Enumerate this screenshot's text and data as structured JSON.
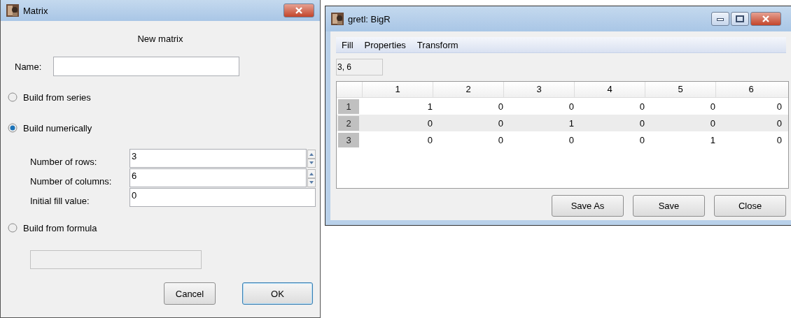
{
  "matrix_dialog": {
    "title": "Matrix",
    "heading": "New matrix",
    "name_label": "Name:",
    "options": [
      {
        "label": "Build from series",
        "selected": false
      },
      {
        "label": "Build numerically",
        "selected": true,
        "fields": [
          {
            "label": "Number of rows:",
            "value": "3",
            "kind": "spin"
          },
          {
            "label": "Number of columns:",
            "value": "6",
            "kind": "spin"
          },
          {
            "label": "Initial fill value:",
            "value": "0",
            "kind": "entry"
          }
        ]
      },
      {
        "label": "Build from formula",
        "selected": false
      }
    ],
    "buttons": [
      {
        "label": "Cancel",
        "selected": false
      },
      {
        "label": "OK",
        "selected": true
      }
    ]
  },
  "viewer_window": {
    "title": "gretl: BigR",
    "menu": [
      "Fill",
      "Properties",
      "Transform"
    ],
    "dimensions": "3, 6",
    "table": {
      "columns": [
        "1",
        "2",
        "3",
        "4",
        "5",
        "6"
      ],
      "rows": [
        {
          "header": "1",
          "cells": [
            "1",
            "0",
            "0",
            "0",
            "0",
            "0"
          ]
        },
        {
          "header": "2",
          "cells": [
            "0",
            "0",
            "1",
            "0",
            "0",
            "0"
          ]
        },
        {
          "header": "3",
          "cells": [
            "0",
            "0",
            "0",
            "0",
            "1",
            "0"
          ]
        }
      ]
    },
    "buttons": [
      "Save As",
      "Save",
      "Close"
    ]
  }
}
